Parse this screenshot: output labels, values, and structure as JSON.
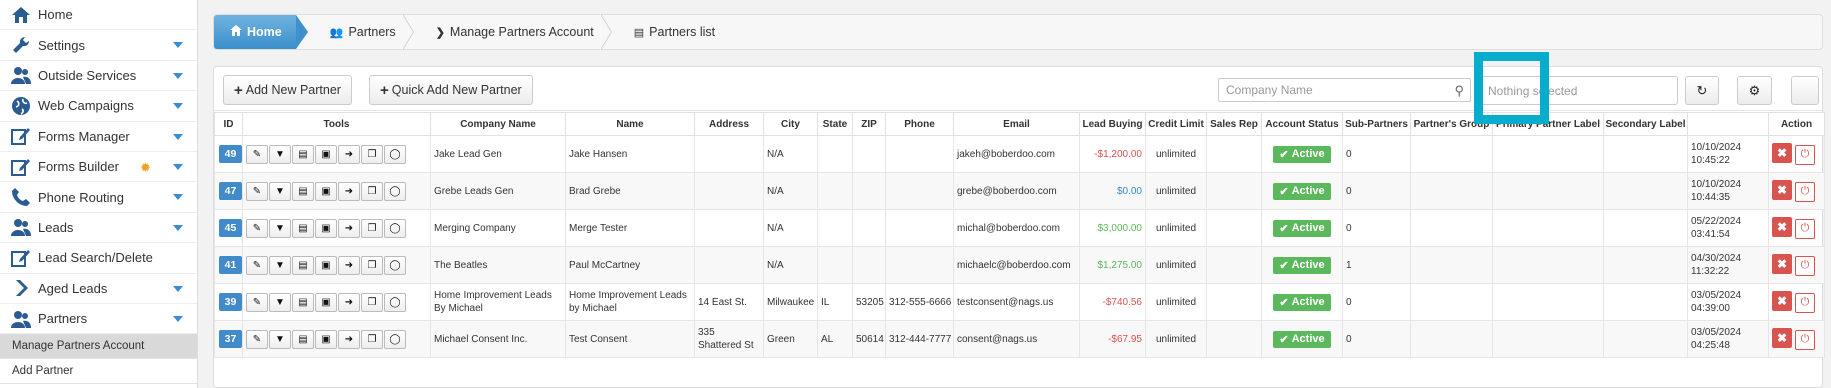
{
  "sidebar": {
    "items": [
      {
        "label": "Home",
        "icon": "home-icon",
        "caret": false
      },
      {
        "label": "Settings",
        "icon": "wrench-icon",
        "caret": true
      },
      {
        "label": "Outside Services",
        "icon": "users-icon",
        "caret": true
      },
      {
        "label": "Web Campaigns",
        "icon": "globe-icon",
        "caret": true
      },
      {
        "label": "Forms Manager",
        "icon": "edit-icon",
        "caret": true
      },
      {
        "label": "Forms Builder",
        "icon": "edit-icon",
        "caret": true
      },
      {
        "label": "Phone Routing",
        "icon": "phone-icon",
        "caret": true
      },
      {
        "label": "Leads",
        "icon": "users-icon",
        "caret": true
      },
      {
        "label": "Lead Search/Delete",
        "icon": "edit-icon",
        "caret": false
      },
      {
        "label": "Aged Leads",
        "icon": "chevron-right-icon",
        "caret": true
      },
      {
        "label": "Partners",
        "icon": "users-icon",
        "caret": true
      }
    ],
    "subitems": [
      {
        "label": "Manage Partners Account",
        "active": true
      },
      {
        "label": "Add Partner",
        "active": false
      }
    ]
  },
  "breadcrumb": {
    "home": "Home",
    "items": [
      "Partners",
      "Manage Partners Account",
      "Partners list"
    ]
  },
  "toolbar": {
    "add_partner": "Add New Partner",
    "quick_add": "Quick Add New Partner",
    "company_placeholder": "Company Name",
    "select_placeholder": "Nothing selected"
  },
  "table": {
    "columns": [
      "ID",
      "Tools",
      "Company Name",
      "Name",
      "Address",
      "City",
      "State",
      "ZIP",
      "Phone",
      "Email",
      "Lead Buying",
      "Credit Limit",
      "Sales Rep",
      "Account Status",
      "Sub-Partners",
      "Partner's Group",
      "Primary Partner Label",
      "Secondary Label",
      "",
      "Action"
    ],
    "rows": [
      {
        "id": "49",
        "company": "Jake Lead Gen",
        "name": "Jake Hansen",
        "address": "",
        "city": "N/A",
        "state": "",
        "zip": "",
        "phone": "",
        "email": "jakeh@boberdoo.com",
        "lead_buying": "-$1,200.00",
        "lb_class": "neg",
        "credit": "unlimited",
        "sales_rep": "",
        "status": "Active",
        "sub": "0",
        "group": "",
        "primary": "",
        "secondary": "",
        "date": "10/10/2024",
        "time": "10:45:22"
      },
      {
        "id": "47",
        "company": "Grebe Leads Gen",
        "name": "Brad Grebe",
        "address": "",
        "city": "N/A",
        "state": "",
        "zip": "",
        "phone": "",
        "email": "grebe@boberdoo.com",
        "lead_buying": "$0.00",
        "lb_class": "zero",
        "credit": "unlimited",
        "sales_rep": "",
        "status": "Active",
        "sub": "0",
        "group": "",
        "primary": "",
        "secondary": "",
        "date": "10/10/2024",
        "time": "10:44:35"
      },
      {
        "id": "45",
        "company": "Merging Company",
        "name": "Merge Tester",
        "address": "",
        "city": "N/A",
        "state": "",
        "zip": "",
        "phone": "",
        "email": "michal@boberdoo.com",
        "lead_buying": "$3,000.00",
        "lb_class": "pos",
        "credit": "unlimited",
        "sales_rep": "",
        "status": "Active",
        "sub": "0",
        "group": "",
        "primary": "",
        "secondary": "",
        "date": "05/22/2024",
        "time": "03:41:54"
      },
      {
        "id": "41",
        "company": "The Beatles",
        "name": "Paul McCartney",
        "address": "",
        "city": "N/A",
        "state": "",
        "zip": "",
        "phone": "",
        "email": "michaelc@boberdoo.com",
        "lead_buying": "$1,275.00",
        "lb_class": "pos",
        "credit": "unlimited",
        "sales_rep": "",
        "status": "Active",
        "sub": "1",
        "group": "",
        "primary": "",
        "secondary": "",
        "date": "04/30/2024",
        "time": "11:32:22"
      },
      {
        "id": "39",
        "company": "Home Improvement Leads By Michael",
        "name": "Home Improvement Leads by Michael",
        "address": "14 East St.",
        "city": "Milwaukee",
        "state": "IL",
        "zip": "53205",
        "phone": "312-555-6666",
        "email": "testconsent@nags.us",
        "lead_buying": "-$740.56",
        "lb_class": "neg",
        "credit": "unlimited",
        "sales_rep": "",
        "status": "Active",
        "sub": "0",
        "group": "",
        "primary": "",
        "secondary": "",
        "date": "03/05/2024",
        "time": "04:39:00"
      },
      {
        "id": "37",
        "company": "Michael Consent Inc.",
        "name": "Test Consent",
        "address": "335 Shattered St",
        "city": "Green",
        "state": "AL",
        "zip": "50614",
        "phone": "312-444-7777",
        "email": "consent@nags.us",
        "lead_buying": "-$67.95",
        "lb_class": "neg",
        "credit": "unlimited",
        "sales_rep": "",
        "status": "Active",
        "sub": "0",
        "group": "",
        "primary": "",
        "secondary": "",
        "date": "03/05/2024",
        "time": "04:25:48"
      }
    ]
  }
}
